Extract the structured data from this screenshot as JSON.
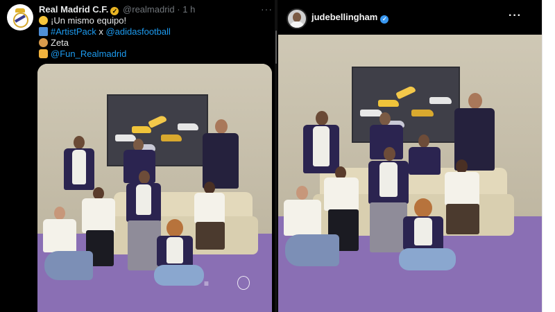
{
  "tweet": {
    "author_name": "Real Madrid C.F.",
    "verified_badge": "gold-check",
    "handle": "@realmadrid",
    "separator": "·",
    "time": "1 h",
    "more_icon": "more-horizontal-icon",
    "more_label": "···",
    "lines": [
      {
        "icon": "grinning-face-emoji",
        "text": "¡Un mismo equipo!"
      },
      {
        "icon": "tshirt-emoji",
        "text_link": "#ArtistPack",
        "text_mid": " x ",
        "text_link2": "@adidasfootball"
      },
      {
        "icon": "palette-emoji",
        "text": "Zeta"
      },
      {
        "icon": "handshake-emoji",
        "text_link": "@Fun_Realmadrid"
      }
    ],
    "photo_marks": {
      "brand_logo": "adidas-logo",
      "club_logo": "real-madrid-crest"
    }
  },
  "instagram": {
    "username": "judebellingham",
    "verified_badge": "blue-check",
    "verified_mark": "✓",
    "more_icon": "more-horizontal-icon",
    "more_label": "···"
  },
  "colors": {
    "background": "#000000",
    "link": "#1d9bf0",
    "muted": "#71767b",
    "text": "#e7e9ea",
    "floor_purple": "#8a6fb4",
    "jacket_navy": "#2b2450"
  }
}
